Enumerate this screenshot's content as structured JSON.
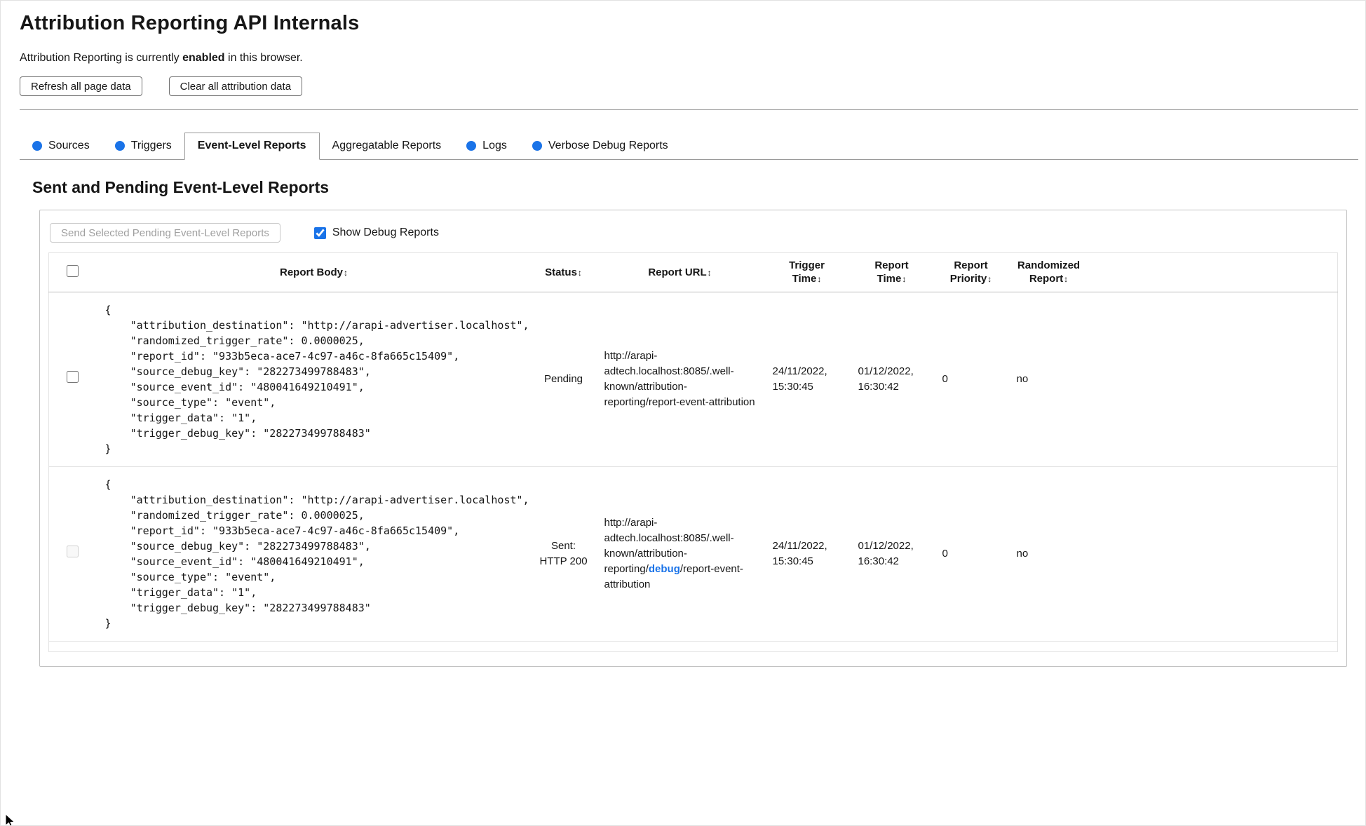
{
  "theme": {
    "accent": "#1a73e8"
  },
  "header": {
    "title": "Attribution Reporting API Internals",
    "status": {
      "prefix": "Attribution Reporting is currently ",
      "emphasis": "enabled",
      "suffix": " in this browser."
    },
    "buttons": {
      "refresh": "Refresh all page data",
      "clear": "Clear all attribution data"
    }
  },
  "tabs": {
    "items": [
      {
        "label": "Sources",
        "has_dot": true,
        "active": false
      },
      {
        "label": "Triggers",
        "has_dot": true,
        "active": false
      },
      {
        "label": "Event-Level Reports",
        "has_dot": false,
        "active": true
      },
      {
        "label": "Aggregatable Reports",
        "has_dot": false,
        "active": false
      },
      {
        "label": "Logs",
        "has_dot": true,
        "active": false
      },
      {
        "label": "Verbose Debug Reports",
        "has_dot": true,
        "active": false
      }
    ]
  },
  "section": {
    "heading": "Sent and Pending Event-Level Reports"
  },
  "controls": {
    "send_button": "Send Selected Pending Event-Level Reports",
    "send_button_disabled": true,
    "show_debug_label": "Show Debug Reports",
    "show_debug_checked": true
  },
  "table": {
    "sort_icon": "↕",
    "select_all_checked": false,
    "headers": [
      "Report Body",
      "Status",
      "Report URL",
      "Trigger\nTime",
      "Report\nTime",
      "Report\nPriority",
      "Randomized\nReport"
    ],
    "rows": [
      {
        "body": "{\n    \"attribution_destination\": \"http://arapi-advertiser.localhost\",\n    \"randomized_trigger_rate\": 0.0000025,\n    \"report_id\": \"933b5eca-ace7-4c97-a46c-8fa665c15409\",\n    \"source_debug_key\": \"282273499788483\",\n    \"source_event_id\": \"480041649210491\",\n    \"source_type\": \"event\",\n    \"trigger_data\": \"1\",\n    \"trigger_debug_key\": \"282273499788483\"\n}",
        "status": "Pending",
        "url_pre": "http://arapi-adtech.localhost:8085/.well-known/attribution-reporting/",
        "url_highlight": "",
        "url_post": "report-event-attribution",
        "trigger_time": "24/11/2022, 15:30:45",
        "report_time": "01/12/2022, 16:30:42",
        "priority": "0",
        "randomized": "no",
        "checked": false,
        "checkbox_disabled": false
      },
      {
        "body": "{\n    \"attribution_destination\": \"http://arapi-advertiser.localhost\",\n    \"randomized_trigger_rate\": 0.0000025,\n    \"report_id\": \"933b5eca-ace7-4c97-a46c-8fa665c15409\",\n    \"source_debug_key\": \"282273499788483\",\n    \"source_event_id\": \"480041649210491\",\n    \"source_type\": \"event\",\n    \"trigger_data\": \"1\",\n    \"trigger_debug_key\": \"282273499788483\"\n}",
        "status": "Sent: HTTP 200",
        "url_pre": "http://arapi-adtech.localhost:8085/.well-known/attribution-reporting/",
        "url_highlight": "debug",
        "url_post": "/report-event-attribution",
        "trigger_time": "24/11/2022, 15:30:45",
        "report_time": "01/12/2022, 16:30:42",
        "priority": "0",
        "randomized": "no",
        "checked": false,
        "checkbox_disabled": true
      }
    ]
  }
}
